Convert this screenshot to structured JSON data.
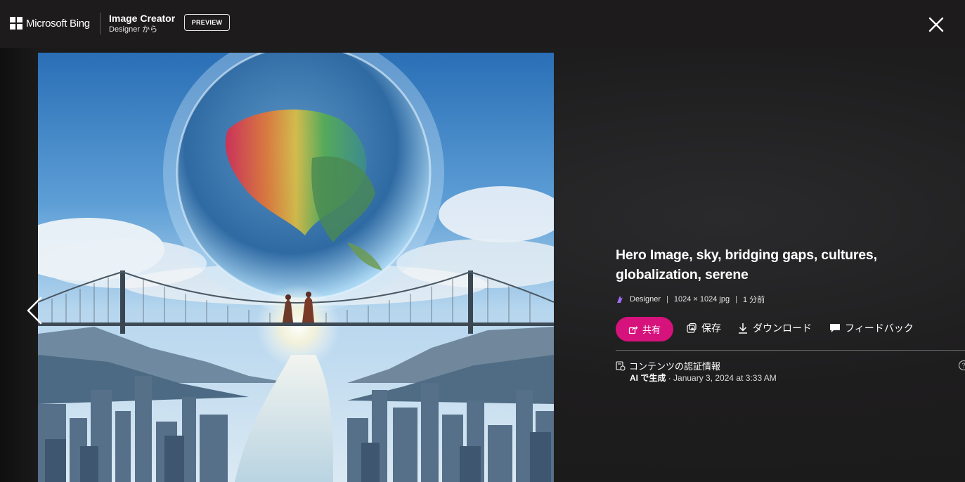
{
  "header": {
    "brand": "Microsoft Bing",
    "product_title": "Image Creator",
    "product_subtitle": "Designer から",
    "badge": "PREVIEW",
    "close_icon": "close-icon"
  },
  "image": {
    "alt_icon": "generated-image",
    "nav_prev_icon": "chevron-left-icon"
  },
  "details": {
    "title": "Hero Image, sky, bridging gaps, cultures, globalization, serene",
    "meta": {
      "source": "Designer",
      "dimensions": "1024 × 1024 jpg",
      "age": "1 分前"
    },
    "actions": {
      "share": "共有",
      "save": "保存",
      "download": "ダウンロード",
      "feedback": "フィードバック"
    },
    "credential": {
      "label": "コンテンツの認証情報",
      "generated_by": "AI で生成",
      "timestamp": "· January 3, 2024 at 3:33 AM",
      "help_glyph": "?"
    },
    "colors": {
      "share_button": "#d6127c",
      "background": "#1d1b1b"
    }
  }
}
